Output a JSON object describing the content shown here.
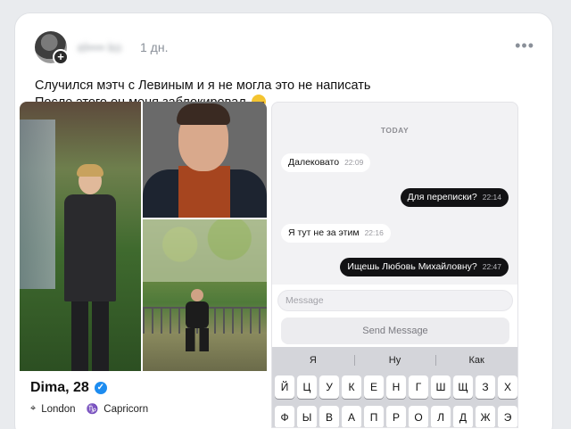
{
  "post": {
    "author": "el•••• ko",
    "time": "1 дн.",
    "more_icon": "more-horizontal-icon",
    "text_line1": "Случился мэтч с Левиным и я не могла это не написать",
    "text_line2": "После этого он меня заблокировал"
  },
  "profile": {
    "name": "Dima, 28",
    "location": "London",
    "zodiac": "Capricorn"
  },
  "chat": {
    "day_label": "TODAY",
    "messages": [
      {
        "text": "Далековато",
        "time": "22:09",
        "direction": "in"
      },
      {
        "text": "Для переписки?",
        "time": "22:14",
        "direction": "out"
      },
      {
        "text": "Я тут не за этим",
        "time": "22:16",
        "direction": "in"
      },
      {
        "text": "Ищешь Любовь Михайловну?",
        "time": "22:47",
        "direction": "out"
      }
    ],
    "input_placeholder": "Message",
    "send_label": "Send Message"
  },
  "keyboard": {
    "suggestions": [
      "Я",
      "Ну",
      "Как"
    ],
    "row1": [
      "Й",
      "Ц",
      "У",
      "К",
      "Е",
      "Н",
      "Г",
      "Ш",
      "Щ",
      "З",
      "Х"
    ],
    "row2": [
      "Ф",
      "Ы",
      "В",
      "А",
      "П",
      "Р",
      "О",
      "Л",
      "Д",
      "Ж",
      "Э"
    ]
  },
  "colors": {
    "outgoing_bubble": "#121214",
    "incoming_bubble": "#ffffff",
    "verified": "#1d8cf0"
  }
}
